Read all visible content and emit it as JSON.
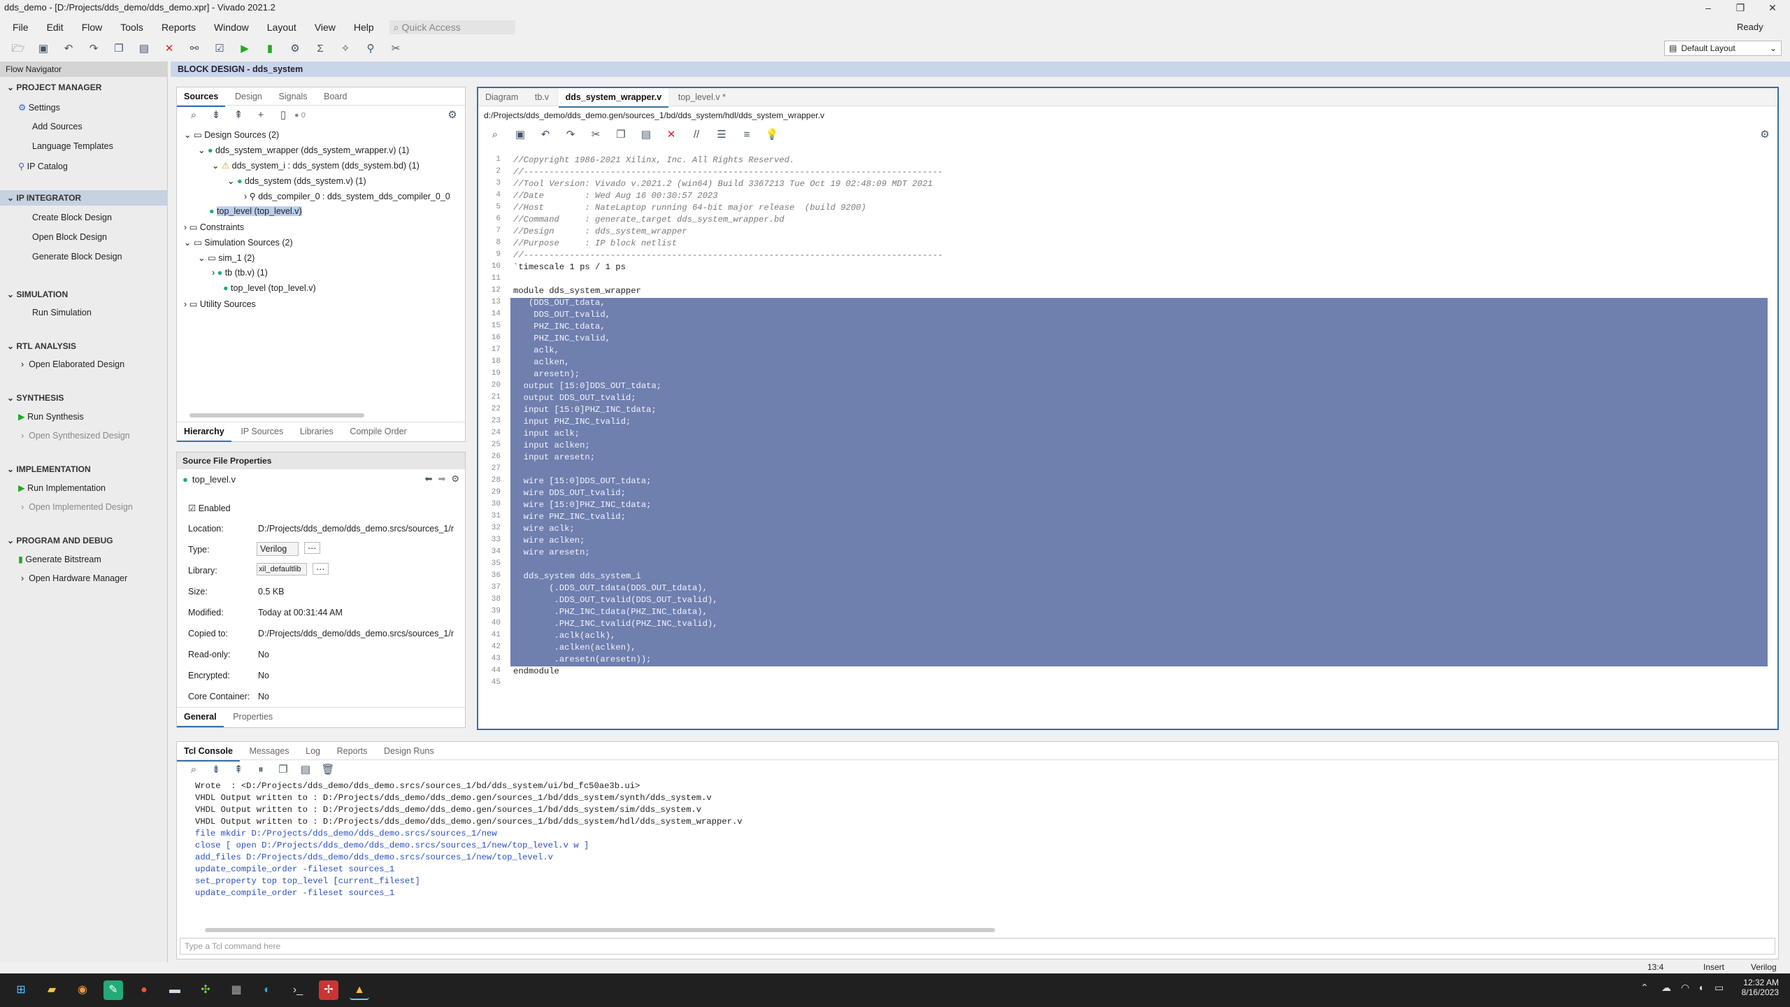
{
  "window": {
    "title": "dds_demo - [D:/Projects/dds_demo/dds_demo.xpr] - Vivado 2021.2",
    "status": "Ready",
    "layout": "Default Layout"
  },
  "menu": [
    "File",
    "Edit",
    "Flow",
    "Tools",
    "Reports",
    "Window",
    "Layout",
    "View",
    "Help"
  ],
  "quick_access": "Quick Access",
  "flow_navigator": {
    "title": "Flow Navigator",
    "sections": [
      {
        "label": "PROJECT MANAGER",
        "items": [
          "Settings",
          "Add Sources",
          "Language Templates",
          "IP Catalog"
        ]
      },
      {
        "label": "IP INTEGRATOR",
        "items": [
          "Create Block Design",
          "Open Block Design",
          "Generate Block Design"
        ]
      },
      {
        "label": "SIMULATION",
        "items": [
          "Run Simulation"
        ]
      },
      {
        "label": "RTL ANALYSIS",
        "items": [
          "Open Elaborated Design"
        ]
      },
      {
        "label": "SYNTHESIS",
        "items": [
          "Run Synthesis",
          "Open Synthesized Design"
        ]
      },
      {
        "label": "IMPLEMENTATION",
        "items": [
          "Run Implementation",
          "Open Implemented Design"
        ]
      },
      {
        "label": "PROGRAM AND DEBUG",
        "items": [
          "Generate Bitstream",
          "Open Hardware Manager"
        ]
      }
    ]
  },
  "block_design_title": "BLOCK DESIGN - dds_system",
  "sources": {
    "tabs": [
      "Sources",
      "Design",
      "Signals",
      "Board"
    ],
    "count_badge": "0",
    "tree": [
      "Design Sources (2)",
      "dds_system_wrapper (dds_system_wrapper.v) (1)",
      "dds_system_i : dds_system (dds_system.bd) (1)",
      "dds_system (dds_system.v) (1)",
      "dds_compiler_0 : dds_system_dds_compiler_0_0",
      "top_level (top_level.v)",
      "Constraints",
      "Simulation Sources (2)",
      "sim_1 (2)",
      "tb (tb.v) (1)",
      "top_level (top_level.v)",
      "Utility Sources"
    ],
    "bottom_tabs": [
      "Hierarchy",
      "IP Sources",
      "Libraries",
      "Compile Order"
    ]
  },
  "props": {
    "title": "Source File Properties",
    "file": "top_level.v",
    "enabled": "Enabled",
    "rows": [
      {
        "k": "Location:",
        "v": "D:/Projects/dds_demo/dds_demo.srcs/sources_1/r"
      },
      {
        "k": "Type:",
        "v": "Verilog"
      },
      {
        "k": "Library:",
        "v": "xil_defaultlib"
      },
      {
        "k": "Size:",
        "v": "0.5 KB"
      },
      {
        "k": "Modified:",
        "v": "Today at 00:31:44 AM"
      },
      {
        "k": "Copied to:",
        "v": "D:/Projects/dds_demo/dds_demo.srcs/sources_1/r"
      },
      {
        "k": "Read-only:",
        "v": "No"
      },
      {
        "k": "Encrypted:",
        "v": "No"
      },
      {
        "k": "Core Container:",
        "v": "No"
      }
    ],
    "tabs": [
      "General",
      "Properties"
    ]
  },
  "editor": {
    "tabs": [
      "Diagram",
      "tb.v",
      "dds_system_wrapper.v",
      "top_level.v *"
    ],
    "path": "d:/Projects/dds_demo/dds_demo.gen/sources_1/bd/dds_system/hdl/dds_system_wrapper.v",
    "lines": [
      "//Copyright 1986-2021 Xilinx, Inc. All Rights Reserved.",
      "//----------------------------------------------------------------------------------",
      "//Tool Version: Vivado v.2021.2 (win64) Build 3367213 Tue Oct 19 02:48:09 MDT 2021",
      "//Date        : Wed Aug 16 00:30:57 2023",
      "//Host        : NateLaptop running 64-bit major release  (build 9200)",
      "//Command     : generate_target dds_system_wrapper.bd",
      "//Design      : dds_system_wrapper",
      "//Purpose     : IP block netlist",
      "//----------------------------------------------------------------------------------",
      "`timescale 1 ps / 1 ps",
      "",
      "module dds_system_wrapper",
      "   (DDS_OUT_tdata,",
      "    DDS_OUT_tvalid,",
      "    PHZ_INC_tdata,",
      "    PHZ_INC_tvalid,",
      "    aclk,",
      "    aclken,",
      "    aresetn);",
      "  output [15:0]DDS_OUT_tdata;",
      "  output DDS_OUT_tvalid;",
      "  input [15:0]PHZ_INC_tdata;",
      "  input PHZ_INC_tvalid;",
      "  input aclk;",
      "  input aclken;",
      "  input aresetn;",
      "",
      "  wire [15:0]DDS_OUT_tdata;",
      "  wire DDS_OUT_tvalid;",
      "  wire [15:0]PHZ_INC_tdata;",
      "  wire PHZ_INC_tvalid;",
      "  wire aclk;",
      "  wire aclken;",
      "  wire aresetn;",
      "",
      "  dds_system dds_system_i",
      "       (.DDS_OUT_tdata(DDS_OUT_tdata),",
      "        .DDS_OUT_tvalid(DDS_OUT_tvalid),",
      "        .PHZ_INC_tdata(PHZ_INC_tdata),",
      "        .PHZ_INC_tvalid(PHZ_INC_tvalid),",
      "        .aclk(aclk),",
      "        .aclken(aclken),",
      "        .aresetn(aresetn));",
      "endmodule",
      ""
    ]
  },
  "console": {
    "tabs": [
      "Tcl Console",
      "Messages",
      "Log",
      "Reports",
      "Design Runs"
    ],
    "lines": [
      "Wrote  : <D:/Projects/dds_demo/dds_demo.srcs/sources_1/bd/dds_system/ui/bd_fc50ae3b.ui>",
      "VHDL Output written to : D:/Projects/dds_demo/dds_demo.gen/sources_1/bd/dds_system/synth/dds_system.v",
      "VHDL Output written to : D:/Projects/dds_demo/dds_demo.gen/sources_1/bd/dds_system/sim/dds_system.v",
      "VHDL Output written to : D:/Projects/dds_demo/dds_demo.gen/sources_1/bd/dds_system/hdl/dds_system_wrapper.v",
      "file mkdir D:/Projects/dds_demo/dds_demo.srcs/sources_1/new",
      "close [ open D:/Projects/dds_demo/dds_demo.srcs/sources_1/new/top_level.v w ]",
      "add_files D:/Projects/dds_demo/dds_demo.srcs/sources_1/new/top_level.v",
      "update_compile_order -fileset sources_1",
      "set_property top top_level [current_fileset]",
      "update_compile_order -fileset sources_1"
    ],
    "placeholder": "Type a Tcl command here"
  },
  "status": {
    "pos": "13:4",
    "mode": "Insert",
    "lang": "Verilog"
  },
  "clock": {
    "time": "12:32 AM",
    "date": "8/16/2023"
  }
}
